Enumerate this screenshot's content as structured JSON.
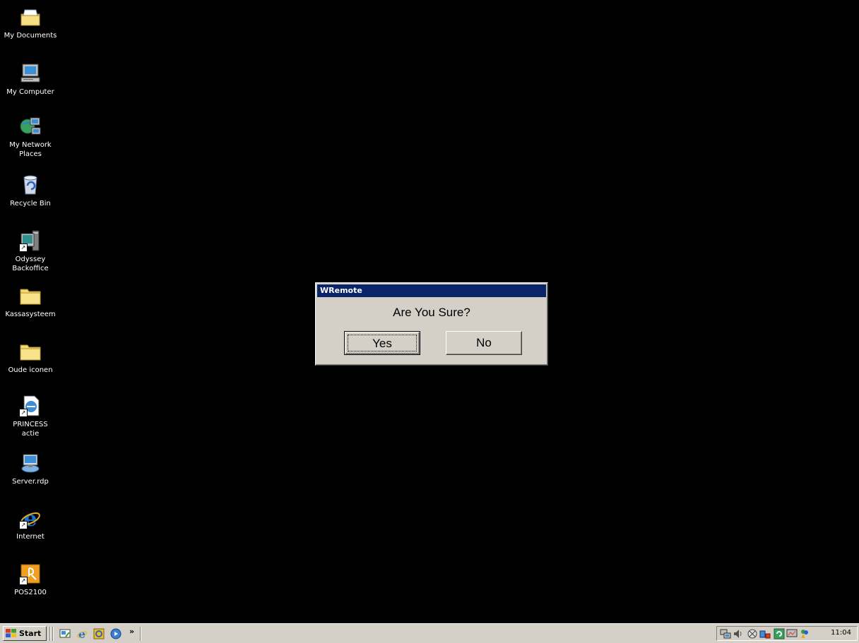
{
  "desktop": {
    "icons": [
      {
        "label": "My Documents",
        "icon": "my-documents-folder-icon"
      },
      {
        "label": "My Computer",
        "icon": "my-computer-icon"
      },
      {
        "label": "My Network\nPlaces",
        "icon": "network-places-icon"
      },
      {
        "label": "Recycle Bin",
        "icon": "recycle-bin-icon"
      },
      {
        "label": "Odyssey\nBackoffice",
        "icon": "application-shortcut-icon"
      },
      {
        "label": "Kassasysteem",
        "icon": "folder-icon"
      },
      {
        "label": "Oude iconen",
        "icon": "folder-icon"
      },
      {
        "label": "PRINCESS\nactie",
        "icon": "document-shortcut-icon"
      },
      {
        "label": "Server.rdp",
        "icon": "remote-desktop-icon"
      },
      {
        "label": "Internet",
        "icon": "internet-explorer-icon"
      },
      {
        "label": "POS2100",
        "icon": "pos-shortcut-icon"
      }
    ]
  },
  "dialog": {
    "title": "WRemote",
    "message": "Are You Sure?",
    "yes_label": "Yes",
    "no_label": "No"
  },
  "taskbar": {
    "start_label": "Start",
    "quick_launch": [
      "show-desktop-icon",
      "internet-explorer-icon",
      "outlook-icon",
      "media-player-icon"
    ],
    "more_label": "»",
    "clock": "11:04"
  },
  "colors": {
    "desktop": "#000000",
    "titlebar": "#0a246a",
    "face": "#d4d0c8"
  }
}
